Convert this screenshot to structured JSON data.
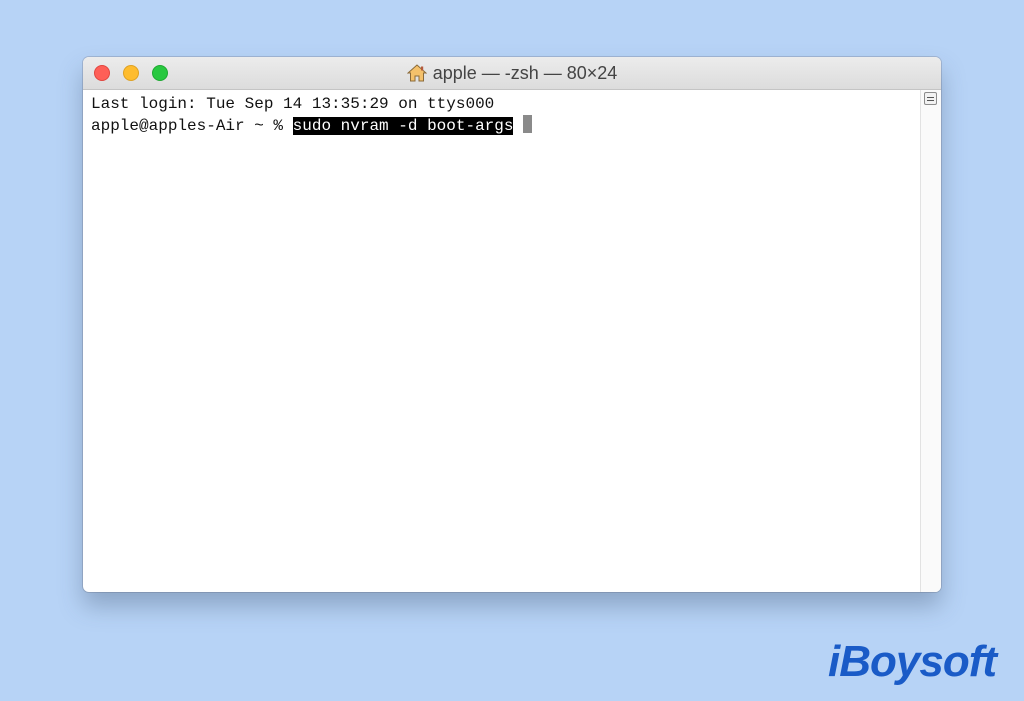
{
  "window": {
    "title": "apple — -zsh — 80×24",
    "title_icon": "home-icon"
  },
  "terminal": {
    "line1": "Last login: Tue Sep 14 13:35:29 on ttys000",
    "prompt": "apple@apples-Air ~ % ",
    "command": "sudo nvram -d boot-args"
  },
  "branding": {
    "logo_text": "iBoysoft"
  },
  "colors": {
    "background": "#b7d3f6",
    "close": "#fe5f57",
    "minimize": "#febc2e",
    "maximize": "#28c840",
    "logo": "#1a5bc7"
  }
}
